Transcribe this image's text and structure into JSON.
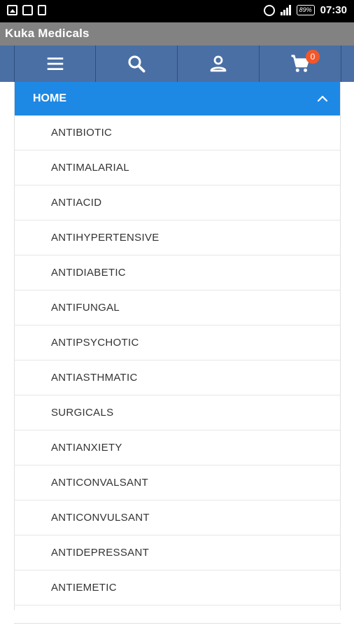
{
  "status_bar": {
    "time": "07:30",
    "battery": "89%"
  },
  "app": {
    "title": "Kuka Medicals"
  },
  "nav": {
    "menu_icon": "menu-icon",
    "search_icon": "search-icon",
    "account_icon": "account-icon",
    "cart_icon": "cart-icon",
    "cart_count": "0"
  },
  "menu": {
    "header": "HOME",
    "items": [
      "ANTIBIOTIC",
      "ANTIMALARIAL",
      "ANTIACID",
      "ANTIHYPERTENSIVE",
      "ANTIDIABETIC",
      "ANTIFUNGAL",
      "ANTIPSYCHOTIC",
      "ANTIASTHMATIC",
      "SURGICALS",
      "ANTIANXIETY",
      "ANTICONVALSANT",
      "ANTICONVULSANT",
      "ANTIDEPRESSANT",
      "ANTIEMETIC"
    ]
  },
  "colors": {
    "nav_bar": "#4a6fa5",
    "menu_header": "#1e88e5",
    "badge": "#f2572a",
    "title_bar": "#828282"
  }
}
